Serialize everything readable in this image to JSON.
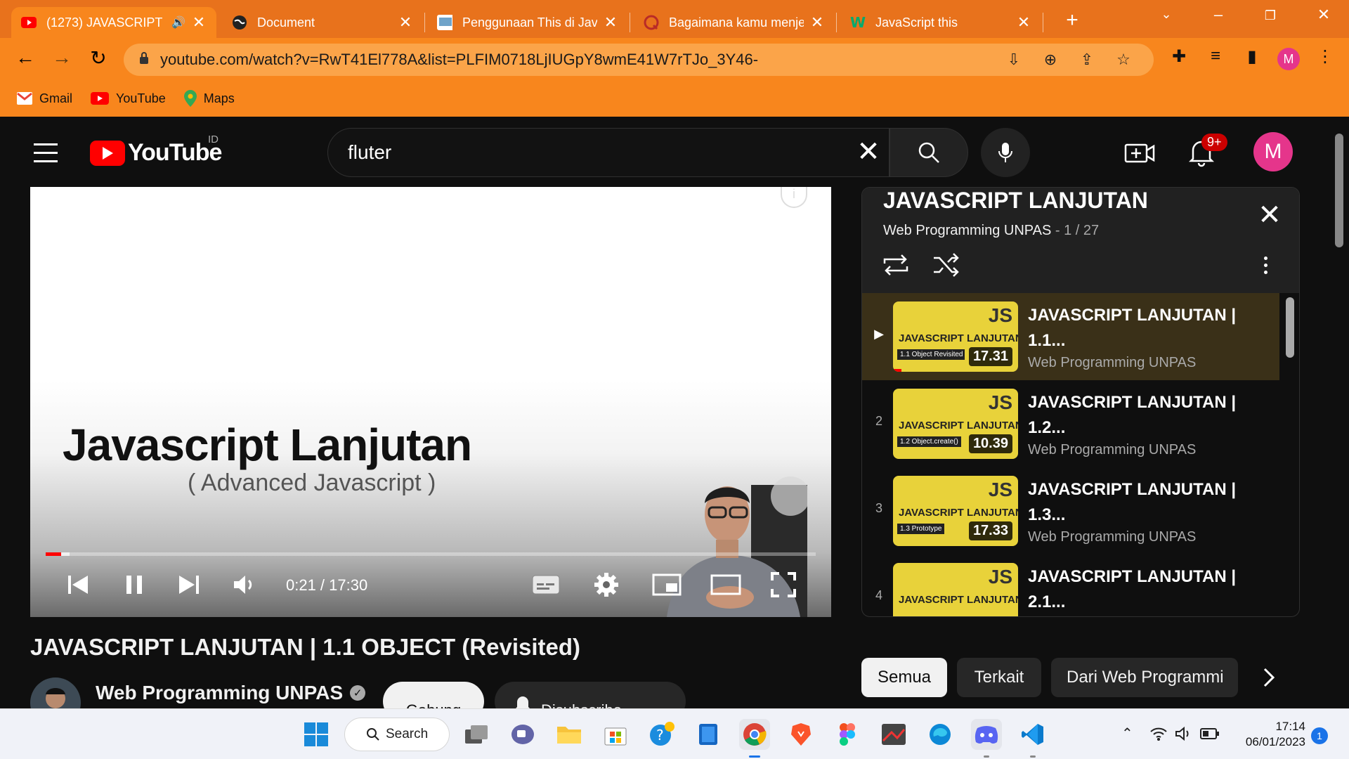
{
  "browser": {
    "tabs": [
      {
        "title": "(1273) JAVASCRIPT",
        "favicon": "youtube-icon",
        "active": true
      },
      {
        "title": "Document",
        "favicon": "globe-icon",
        "active": false
      },
      {
        "title": "Penggunaan This di Java",
        "favicon": "site-icon",
        "active": false
      },
      {
        "title": "Bagaimana kamu menje",
        "favicon": "quora-icon",
        "active": false
      },
      {
        "title": "JavaScript this",
        "favicon": "w3schools-icon",
        "active": false
      }
    ],
    "url": "youtube.com/watch?v=RwT41El778A&list=PLFIM0718LjIUGpY8wmE41W7rTJo_3Y46-",
    "profile_initial": "M",
    "bookmarks": [
      "Gmail",
      "YouTube",
      "Maps"
    ]
  },
  "youtube": {
    "logo_text": "YouTube",
    "country_code": "ID",
    "search_value": "fluter",
    "notification_count": "9+",
    "avatar_initial": "M",
    "player": {
      "slide_title": "Javascript Lanjutan",
      "slide_subtitle": "( Advanced Javascript )",
      "time": "0:21 / 17:30",
      "progress_fraction": 0.02,
      "buffered_fraction": 0.031
    },
    "video_title": "JAVASCRIPT LANJUTAN | 1.1 OBJECT (Revisited)",
    "channel_name": "Web Programming UNPAS",
    "join_label": "Gabung",
    "subscribe_label": "Disubscribe",
    "playlist": {
      "title": "JAVASCRIPT LANJUTAN",
      "owner": "Web Programming UNPAS",
      "position": "1 / 27",
      "items": [
        {
          "index": "▶",
          "thumb_title": "JAVASCRIPT LANJUTAN",
          "thumb_sub": "1.1 Object Revisited",
          "duration": "17.31",
          "title": "JAVASCRIPT LANJUTAN | 1.1...",
          "channel": "Web Programming UNPAS",
          "current": true
        },
        {
          "index": "2",
          "thumb_title": "JAVASCRIPT LANJUTAN",
          "thumb_sub": "1.2 Object.create()",
          "duration": "10.39",
          "title": "JAVASCRIPT LANJUTAN | 1.2...",
          "channel": "Web Programming UNPAS",
          "current": false
        },
        {
          "index": "3",
          "thumb_title": "JAVASCRIPT LANJUTAN",
          "thumb_sub": "1.3 Prototype",
          "duration": "17.33",
          "title": "JAVASCRIPT LANJUTAN | 1.3...",
          "channel": "Web Programming UNPAS",
          "current": false
        },
        {
          "index": "4",
          "thumb_title": "JAVASCRIPT LANJUTAN",
          "thumb_sub": "",
          "duration": "",
          "title": "JAVASCRIPT LANJUTAN | 2.1...",
          "channel": "",
          "current": false
        }
      ]
    },
    "chips": [
      "Semua",
      "Terkait",
      "Dari Web Programmi"
    ]
  },
  "taskbar": {
    "search_label": "Search",
    "time": "17:14",
    "date": "06/01/2023",
    "notification_count": "1"
  },
  "colors": {
    "chrome_frame": "#e8721c",
    "chrome_toolbar": "#f8861d",
    "youtube_red": "#ff0000",
    "youtube_bg": "#0f0f0f",
    "avatar_pink": "#e5358b"
  }
}
